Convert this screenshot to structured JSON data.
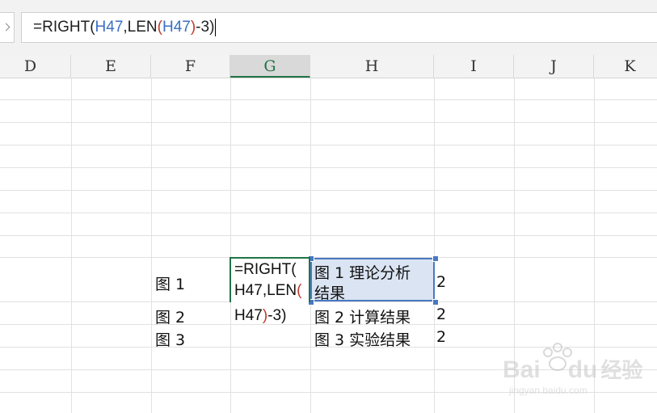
{
  "formula_bar": {
    "eq": "=",
    "fn_right": "RIGHT(",
    "ref1": "H47",
    "comma_len": ",LEN",
    "open_paren": "(",
    "ref2": "H47",
    "close_paren": ")",
    "tail": "-3)"
  },
  "columns": [
    "D",
    "E",
    "F",
    "G",
    "H",
    "I",
    "J",
    "K"
  ],
  "active_column": "G",
  "cells": {
    "f1": "图 1",
    "f2": "图 2",
    "f3": "图 3",
    "g_edit_line1": "=RIGHT(",
    "g_edit_line2_a": "H47,LEN",
    "g_edit_line2_b": "(",
    "g_edit_line3_a": "H47",
    "g_edit_line3_b": ")",
    "g_edit_line3_c": "-3)",
    "h1_line1": "图 1 理论分析",
    "h1_line2": "结果",
    "h2": "图 2 计算结果",
    "h3": "图 3 实验结果",
    "i1": "2",
    "i2": "2",
    "i3": "2"
  },
  "watermark": {
    "brand_a": "Bai",
    "brand_b": "du",
    "brand_cn": "经验",
    "url": "jingyan.baidu.com"
  },
  "colors": {
    "reference_blue": "#3b6fc2",
    "paren_red": "#c0392b",
    "active_green": "#217346",
    "selection_fill": "#dbe4f3",
    "selection_border": "#4a78c2"
  }
}
